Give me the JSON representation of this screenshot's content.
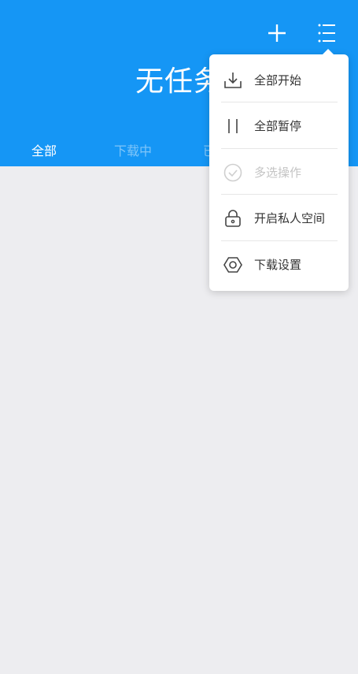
{
  "header": {
    "title": "无任务",
    "add_icon": "plus-icon",
    "menu_icon": "list-menu-icon",
    "background_color": "#1596f5"
  },
  "tabs": [
    {
      "label": "全部"
    },
    {
      "label": "下载中"
    },
    {
      "label": "已"
    }
  ],
  "menu": {
    "items": [
      {
        "label": "全部开始",
        "icon": "download-icon"
      },
      {
        "label": "全部暂停",
        "icon": "pause-icon"
      },
      {
        "label": "多选操作",
        "icon": "check-circle-icon",
        "disabled": true
      },
      {
        "label": "开启私人空间",
        "icon": "lock-icon"
      },
      {
        "label": "下载设置",
        "icon": "hexagon-settings-icon"
      }
    ]
  }
}
